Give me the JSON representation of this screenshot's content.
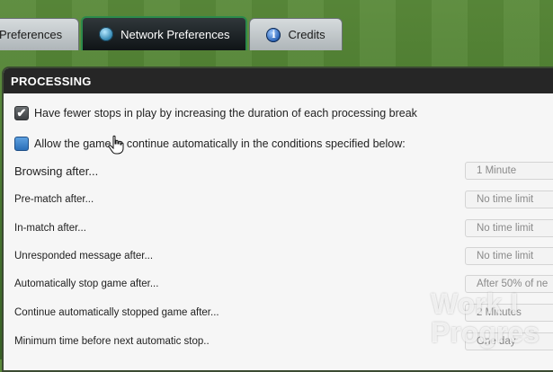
{
  "tabs": [
    {
      "label": "Preferences",
      "icon": "none",
      "active": false
    },
    {
      "label": "Network Preferences",
      "icon": "globe-icon",
      "active": true
    },
    {
      "label": "Credits",
      "icon": "info-icon",
      "active": false
    }
  ],
  "section": {
    "title": "PROCESSING"
  },
  "options": [
    {
      "label": "Have fewer stops in play by increasing the duration of each processing break",
      "checked": true
    },
    {
      "label": "Allow the game to continue automatically in the conditions specified below:",
      "checked": false
    }
  ],
  "settings": [
    {
      "label": "Browsing after...",
      "value": "1 Minute"
    },
    {
      "label": "Pre-match after...",
      "value": "No time limit"
    },
    {
      "label": "In-match after...",
      "value": "No time limit"
    },
    {
      "label": "Unresponded message after...",
      "value": "No time limit"
    },
    {
      "label": "Automatically stop game after...",
      "value": "After 50% of ne"
    },
    {
      "label": "Continue automatically stopped game after...",
      "value": "2 Minutes"
    },
    {
      "label": "Minimum time before next automatic stop..",
      "value": "One day"
    }
  ],
  "watermark": {
    "line1": "Work I",
    "line2": "Progres"
  },
  "colors": {
    "accent_green": "#2c8a4b",
    "header_bg": "#262626",
    "panel_bg": "#f6f6f6"
  }
}
